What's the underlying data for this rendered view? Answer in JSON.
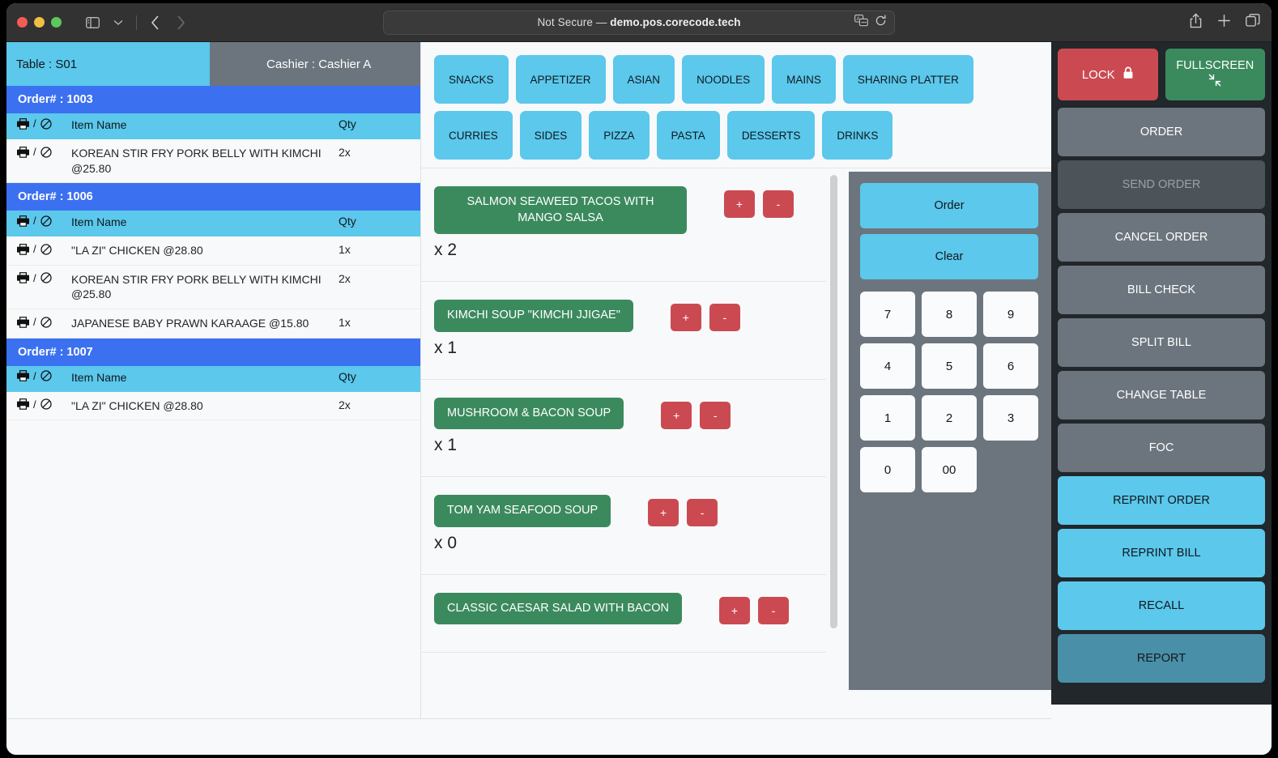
{
  "browser": {
    "url_prefix": "Not Secure — ",
    "url_domain": "demo.pos.corecode.tech"
  },
  "header": {
    "table_label": "Table : S01",
    "cashier_label": "Cashier : Cashier A"
  },
  "orders": [
    {
      "group": "Order# : 1003",
      "col_action": "/",
      "col_name": "Item Name",
      "col_qty": "Qty",
      "rows": [
        {
          "name": "KOREAN STIR FRY PORK BELLY WITH KIMCHI @25.80",
          "qty": "2x"
        }
      ]
    },
    {
      "group": "Order# : 1006",
      "col_action": "/",
      "col_name": "Item Name",
      "col_qty": "Qty",
      "rows": [
        {
          "name": "\"LA ZI\" CHICKEN @28.80",
          "qty": "1x"
        },
        {
          "name": "KOREAN STIR FRY PORK BELLY WITH KIMCHI @25.80",
          "qty": "2x"
        },
        {
          "name": "JAPANESE BABY PRAWN KARAAGE @15.80",
          "qty": "1x"
        }
      ]
    },
    {
      "group": "Order# : 1007",
      "col_action": "/",
      "col_name": "Item Name",
      "col_qty": "Qty",
      "rows": [
        {
          "name": "\"LA ZI\" CHICKEN @28.80",
          "qty": "2x"
        }
      ]
    }
  ],
  "categories": [
    "SNACKS",
    "APPETIZER",
    "ASIAN",
    "NOODLES",
    "MAINS",
    "SHARING PLATTER",
    "CURRIES",
    "SIDES",
    "PIZZA",
    "PASTA",
    "DESSERTS",
    "DRINKS"
  ],
  "menu_items": [
    {
      "name": "SALMON SEAWEED TACOS WITH MANGO SALSA",
      "qty": "x 2",
      "plus": "+",
      "minus": "-"
    },
    {
      "name": "KIMCHI SOUP \"KIMCHI JJIGAE\"",
      "qty": "x 1",
      "plus": "+",
      "minus": "-"
    },
    {
      "name": "MUSHROOM & BACON SOUP",
      "qty": "x 1",
      "plus": "+",
      "minus": "-"
    },
    {
      "name": "TOM YAM SEAFOOD SOUP",
      "qty": "x 0",
      "plus": "+",
      "minus": "-"
    },
    {
      "name": "CLASSIC CAESAR SALAD WITH BACON",
      "qty": "",
      "plus": "+",
      "minus": "-"
    }
  ],
  "keypad": {
    "order": "Order",
    "clear": "Clear",
    "keys": [
      "7",
      "8",
      "9",
      "4",
      "5",
      "6",
      "1",
      "2",
      "3",
      "0",
      "00"
    ]
  },
  "sidebar": {
    "lock": "LOCK",
    "fullscreen": "FULLSCREEN",
    "buttons": [
      {
        "label": "ORDER",
        "style": "gray"
      },
      {
        "label": "SEND ORDER",
        "style": "disabled"
      },
      {
        "label": "CANCEL ORDER",
        "style": "gray"
      },
      {
        "label": "BILL CHECK",
        "style": "gray"
      },
      {
        "label": "SPLIT BILL",
        "style": "gray"
      },
      {
        "label": "CHANGE TABLE",
        "style": "gray"
      },
      {
        "label": "FOC",
        "style": "gray"
      },
      {
        "label": "REPRINT ORDER",
        "style": "cyan"
      },
      {
        "label": "REPRINT BILL",
        "style": "cyan"
      },
      {
        "label": "RECALL",
        "style": "cyan"
      },
      {
        "label": "REPORT",
        "style": "teal"
      }
    ]
  },
  "colors": {
    "cyan": "#5bc8ec",
    "green": "#3b8a5e",
    "red": "#cb4a52",
    "blue": "#3b71f0",
    "gray": "#6c757d",
    "teal": "#4a8fa8",
    "dark": "#22272b"
  }
}
